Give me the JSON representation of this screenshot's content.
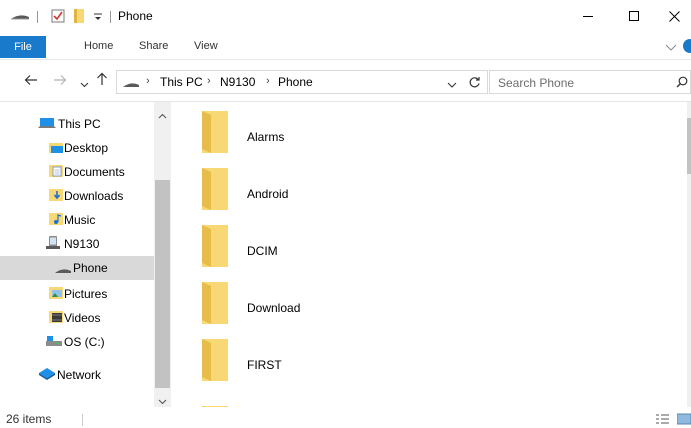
{
  "window": {
    "title": "Phone"
  },
  "ribbon": {
    "tabs": [
      "File",
      "Home",
      "Share",
      "View"
    ]
  },
  "address": {
    "crumbs": [
      "This PC",
      "N9130",
      "Phone"
    ]
  },
  "search": {
    "placeholder": "Search Phone"
  },
  "nav": {
    "items": [
      {
        "label": "This PC",
        "icon": "computer-icon",
        "selected": false
      },
      {
        "label": "Desktop",
        "icon": "desktop-folder-icon",
        "selected": false
      },
      {
        "label": "Documents",
        "icon": "documents-folder-icon",
        "selected": false
      },
      {
        "label": "Downloads",
        "icon": "downloads-folder-icon",
        "selected": false
      },
      {
        "label": "Music",
        "icon": "music-folder-icon",
        "selected": false
      },
      {
        "label": "N9130",
        "icon": "device-icon",
        "selected": false
      },
      {
        "label": "Phone",
        "icon": "phone-storage-icon",
        "selected": true
      },
      {
        "label": "Pictures",
        "icon": "pictures-folder-icon",
        "selected": false
      },
      {
        "label": "Videos",
        "icon": "videos-folder-icon",
        "selected": false
      },
      {
        "label": "OS (C:)",
        "icon": "drive-icon",
        "selected": false
      },
      {
        "label": "Network",
        "icon": "network-icon",
        "selected": false
      }
    ]
  },
  "content": {
    "folders": [
      "Alarms",
      "Android",
      "DCIM",
      "Download",
      "FIRST"
    ]
  },
  "status": {
    "item_count": "26 items"
  },
  "colors": {
    "accent": "#1979ca",
    "folder": "#f8d775",
    "folder_dark": "#e0b440",
    "selection": "#d9d9d9"
  }
}
